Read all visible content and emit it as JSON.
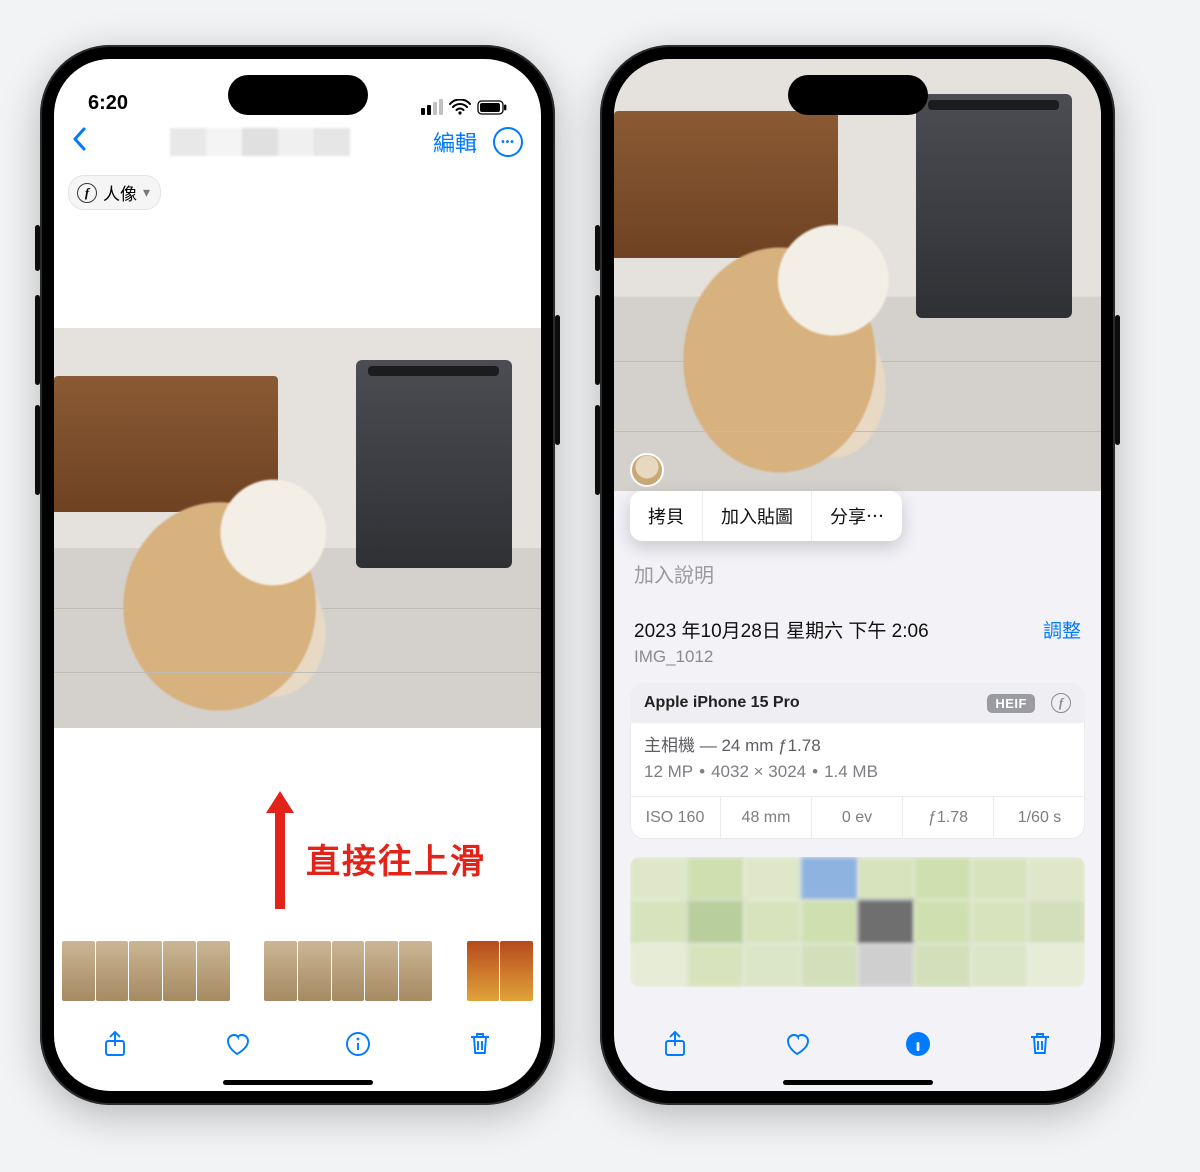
{
  "left": {
    "status_time": "6:20",
    "edit_label": "編輯",
    "chip_label": "人像",
    "annotation": "直接往上滑"
  },
  "right": {
    "menu": {
      "copy": "拷貝",
      "sticker": "加入貼圖",
      "share": "分享⋯"
    },
    "caption_placeholder": "加入說明",
    "date_line": "2023 年10月28日 星期六 下午 2:06",
    "adjust": "調整",
    "img_name": "IMG_1012",
    "device": "Apple iPhone 15 Pro",
    "format_badge": "HEIF",
    "camera_line1": "主相機 — 24 mm ƒ1.78",
    "camera_mp": "12 MP",
    "camera_dims": "4032 × 3024",
    "camera_size": "1.4 MB",
    "exif": {
      "iso": "ISO 160",
      "focal": "48 mm",
      "ev": "0 ev",
      "ap": "ƒ1.78",
      "shutter": "1/60 s"
    }
  },
  "mosaic_colors": [
    "#dfe7c8",
    "#cfe0b0",
    "#dfe7c8",
    "#8fb3e1",
    "#d7e3bd",
    "#cfe0b0",
    "#d7e3bd",
    "#dfe7c8",
    "#d7e3bd",
    "#b9ce9d",
    "#d7e3bd",
    "#cfe0b0",
    "#6f6f6f",
    "#cfe0b0",
    "#d7e3bd",
    "#d2dfba",
    "#e6ecd6",
    "#d7e3bd",
    "#dbe6c6",
    "#d2dfba",
    "#cfcfcf",
    "#d2dfba",
    "#dbe6c6",
    "#e6ecd6"
  ]
}
